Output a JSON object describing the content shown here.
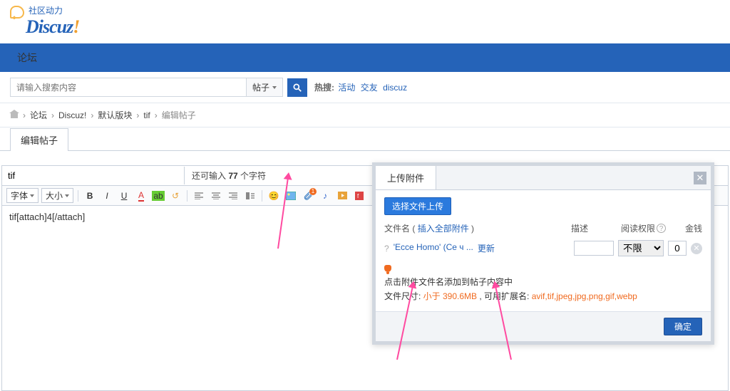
{
  "logo": {
    "cn": "社区动力",
    "text_main": "Discuz",
    "text_bang": "!"
  },
  "nav": {
    "forum": "论坛"
  },
  "search": {
    "placeholder": "请输入搜索内容",
    "type": "帖子",
    "hot_label": "热搜:",
    "hot_links": [
      "活动",
      "交友",
      "discuz"
    ]
  },
  "breadcrumb": [
    "论坛",
    "Discuz!",
    "默认版块",
    "tif",
    "编辑帖子"
  ],
  "tab_label": "编辑帖子",
  "title_input": "tif",
  "char_left_prefix": "还可输入 ",
  "char_left_count": "77",
  "char_left_suffix": " 个字符",
  "toolbar": {
    "font": "字体",
    "size": "大小"
  },
  "editor_content": "tif[attach]4[/attach]",
  "dialog": {
    "tab": "上传附件",
    "upload_btn": "选择文件上传",
    "col_filename": "文件名",
    "insert_all": "插入全部附件",
    "col_desc": "描述",
    "col_perm": "阅读权限",
    "col_money": "金钱",
    "file_display": "'Ecce Homo' (Се ч ...",
    "file_update": "更新",
    "perm_unlimited": "不限",
    "money_value": "0",
    "tip1": "点击附件文件名添加到帖子内容中",
    "tip2_a": "文件尺寸: ",
    "tip2_size": "小于 390.6MB",
    "tip2_b": " , 可用扩展名: ",
    "tip2_ext": "avif,tif,jpeg,jpg,png,gif,webp",
    "ok": "确定"
  }
}
